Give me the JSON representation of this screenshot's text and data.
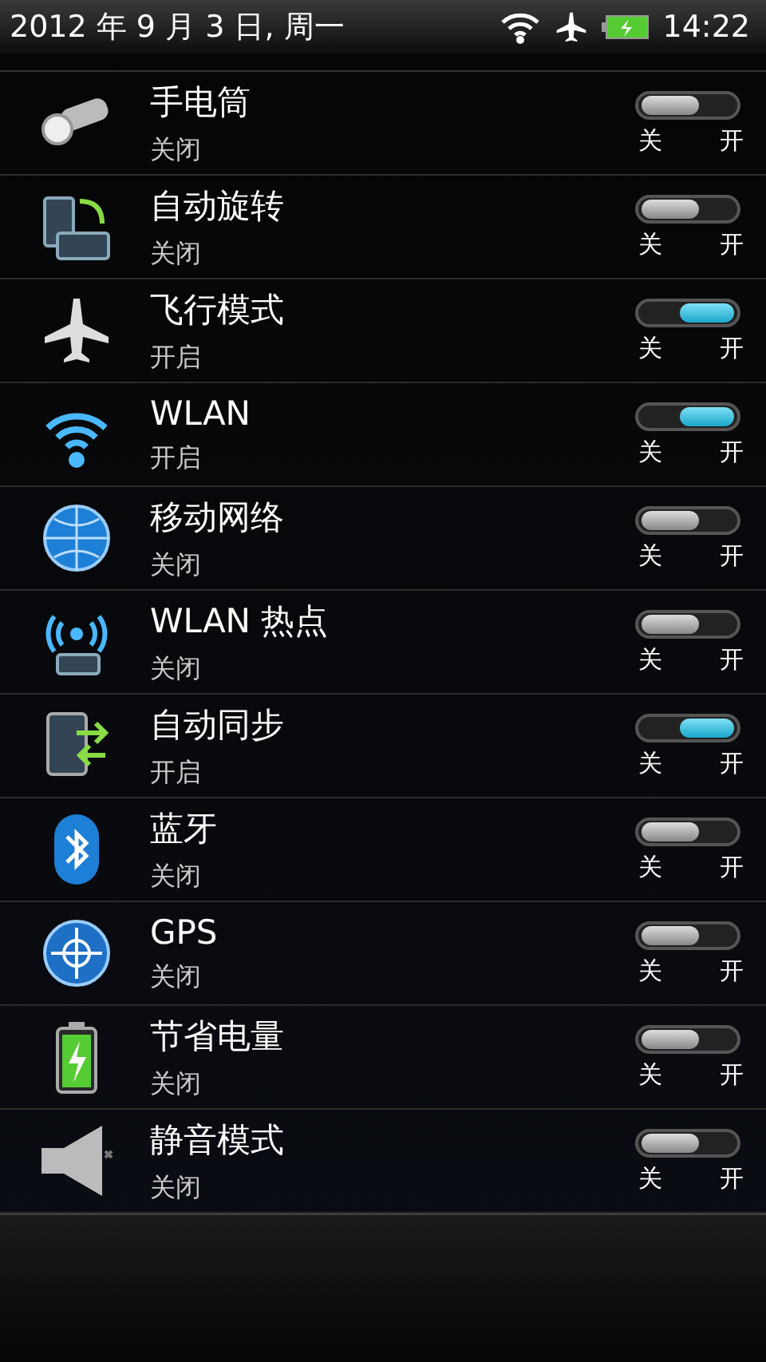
{
  "status_bar": {
    "date": "2012 年 9 月 3 日, 周一",
    "time": "14:22"
  },
  "toggles": [
    {
      "kind": "flashlight",
      "name": "手电筒",
      "status": "关闭",
      "on": false,
      "off_label": "关",
      "on_label": "开"
    },
    {
      "kind": "rotate",
      "name": "自动旋转",
      "status": "关闭",
      "on": false,
      "off_label": "关",
      "on_label": "开"
    },
    {
      "kind": "airplane",
      "name": "飞行模式",
      "status": "开启",
      "on": true,
      "off_label": "关",
      "on_label": "开"
    },
    {
      "kind": "wifi",
      "name": "WLAN",
      "status": "开启",
      "on": true,
      "off_label": "关",
      "on_label": "开"
    },
    {
      "kind": "globe",
      "name": "移动网络",
      "status": "关闭",
      "on": false,
      "off_label": "关",
      "on_label": "开"
    },
    {
      "kind": "hotspot",
      "name": "WLAN 热点",
      "status": "关闭",
      "on": false,
      "off_label": "关",
      "on_label": "开"
    },
    {
      "kind": "sync",
      "name": "自动同步",
      "status": "开启",
      "on": true,
      "off_label": "关",
      "on_label": "开"
    },
    {
      "kind": "bluetooth",
      "name": "蓝牙",
      "status": "关闭",
      "on": false,
      "off_label": "关",
      "on_label": "开"
    },
    {
      "kind": "gps",
      "name": "GPS",
      "status": "关闭",
      "on": false,
      "off_label": "关",
      "on_label": "开"
    },
    {
      "kind": "battery",
      "name": "节省电量",
      "status": "关闭",
      "on": false,
      "off_label": "关",
      "on_label": "开"
    },
    {
      "kind": "speaker",
      "name": "静音模式",
      "status": "关闭",
      "on": false,
      "off_label": "关",
      "on_label": "开"
    }
  ]
}
